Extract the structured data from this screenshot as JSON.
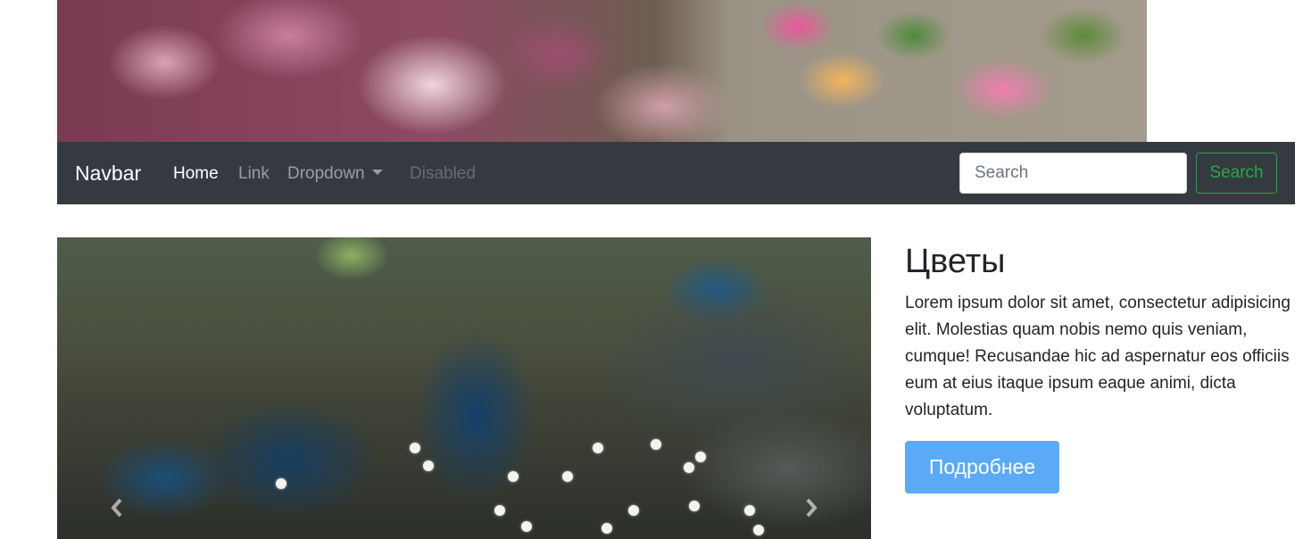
{
  "navbar": {
    "brand": "Navbar",
    "items": [
      {
        "label": "Home",
        "state": "active"
      },
      {
        "label": "Link",
        "state": "normal"
      },
      {
        "label": "Dropdown",
        "state": "dropdown"
      },
      {
        "label": "Disabled",
        "state": "disabled"
      }
    ],
    "search": {
      "placeholder": "Search",
      "button_label": "Search"
    }
  },
  "section": {
    "title": "Цветы",
    "body": "Lorem ipsum dolor sit amet, consectetur adipisicing elit. Molestias quam nobis nemo quis veniam, cumque! Recusandae hic ad aspernatur eos officiis eum at eius itaque ipsum eaque animi, dicta voluptatum.",
    "button_label": "Подробнее"
  },
  "carousel": {
    "prev_icon": "chevron-left-icon",
    "next_icon": "chevron-right-icon"
  },
  "colors": {
    "navbar_bg": "#343a40",
    "search_button": "#28a745",
    "primary_button": "#5aaaf8"
  }
}
